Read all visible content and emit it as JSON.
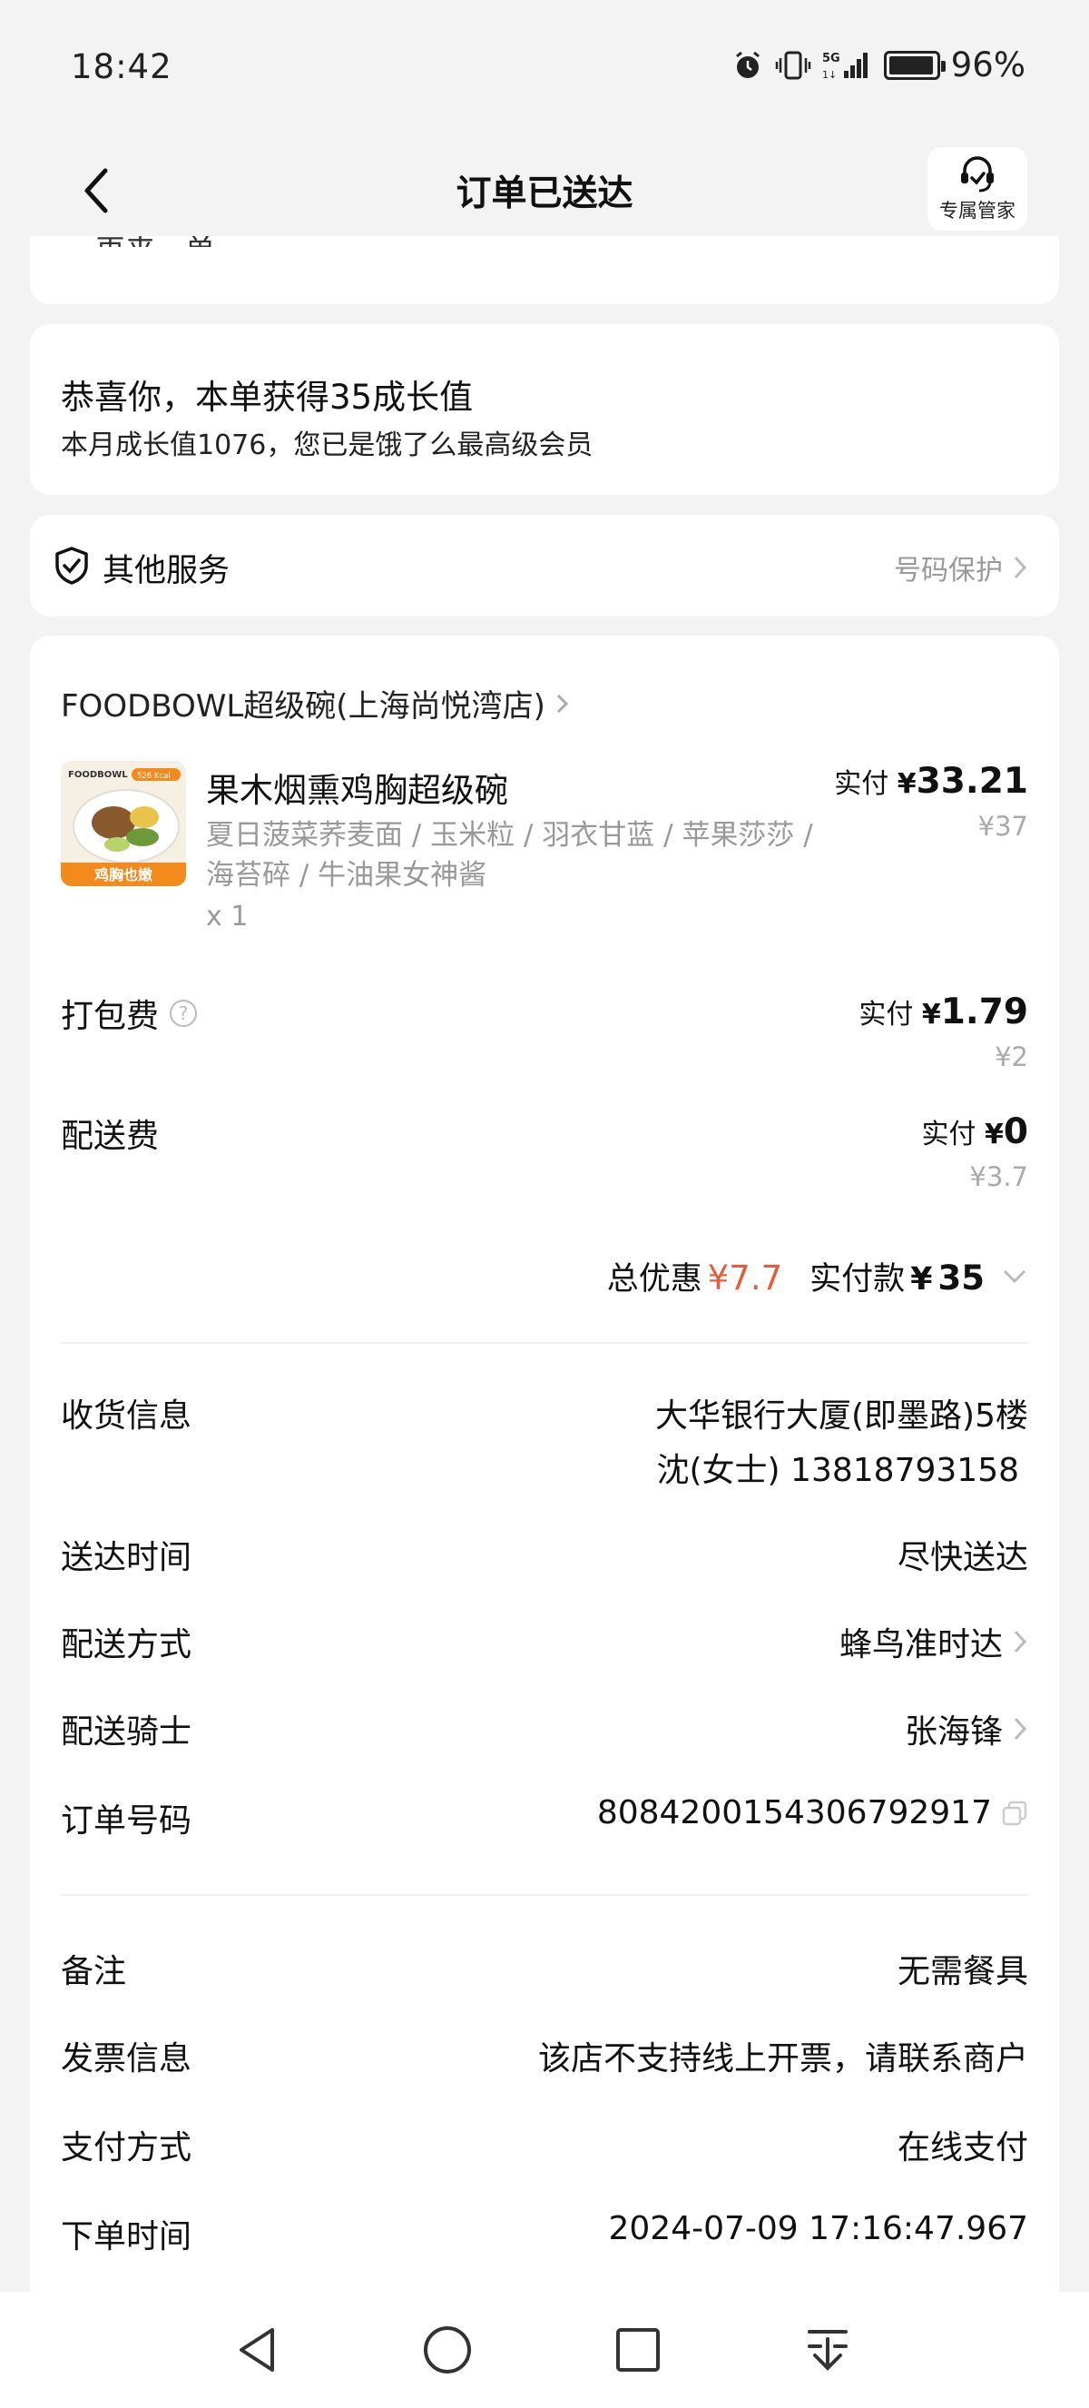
{
  "status_bar": {
    "time": "18:42",
    "network": "5G",
    "battery_percent": "96%",
    "battery_level": 0.96
  },
  "navbar": {
    "title": "订单已送达",
    "butler_label": "专属管家"
  },
  "reorder": {
    "label": "再来一单"
  },
  "growth": {
    "title": "恭喜你，本单获得35成长值",
    "subtitle": "本月成长值1076，您已是饿了么最高级会员"
  },
  "service": {
    "title": "其他服务",
    "link": "号码保护"
  },
  "order": {
    "store_name": "FOODBOWL超级碗(上海尚悦湾店)",
    "item": {
      "thumb_brand": "FOODBOWL",
      "thumb_kcal": "526 Kcal",
      "thumb_tag": "鸡胸也嫩",
      "name": "果木烟熏鸡胸超级碗",
      "desc": "夏日菠菜荞麦面 / 玉米粒 / 羽衣甘蓝 / 苹果莎莎 / 海苔碎 / 牛油果女神酱",
      "qty": "x 1",
      "paid_prefix": "实付",
      "yen": "¥",
      "paid": "33.21",
      "original": "¥37"
    },
    "packing": {
      "label": "打包费",
      "paid_prefix": "实付",
      "yen": "¥",
      "paid": "1.79",
      "original": "¥2"
    },
    "delivery_fee": {
      "label": "配送费",
      "paid_prefix": "实付",
      "yen": "¥",
      "paid": "0",
      "original": "¥3.7"
    },
    "summary": {
      "discount_label": "总优惠",
      "discount_value": "¥7.7",
      "paid_label": "实付款",
      "yen": "¥",
      "paid_value": "35"
    },
    "info": [
      {
        "label": "收货信息",
        "value": "大华银行大厦(即墨路)5楼",
        "value2": "沈(女士) 13818793158"
      },
      {
        "label": "送达时间",
        "value": "尽快送达"
      },
      {
        "label": "配送方式",
        "value": "蜂鸟准时达"
      },
      {
        "label": "配送骑士",
        "value": "张海锋"
      },
      {
        "label": "订单号码",
        "value": "8084200154306792917"
      },
      {
        "label": "备注",
        "value": "无需餐具"
      },
      {
        "label": "发票信息",
        "value": "该店不支持线上开票，请联系商户"
      },
      {
        "label": "支付方式",
        "value": "在线支付"
      },
      {
        "label": "下单时间",
        "value": "2024-07-09 17:16:47.967"
      }
    ]
  },
  "colors": {
    "background": "#f3f3f3",
    "discount": "#e35c3b",
    "muted": "#999999",
    "thumb_tag_bg": "#f28a1c"
  }
}
